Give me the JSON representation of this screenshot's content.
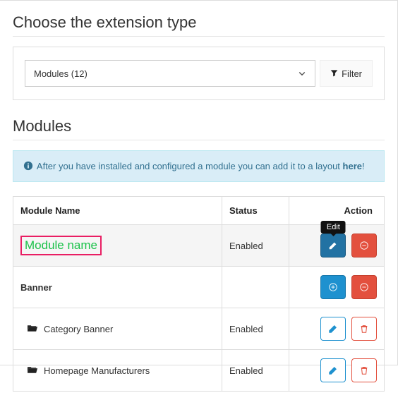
{
  "section1": {
    "title": "Choose the extension type"
  },
  "select": {
    "label": "Modules (12)"
  },
  "filter": {
    "label": "Filter"
  },
  "section2": {
    "title": "Modules"
  },
  "alert": {
    "text": "After you have installed and configured a module you can add it to a layout ",
    "linkText": "here",
    "after": "!"
  },
  "table": {
    "headers": {
      "name": "Module Name",
      "status": "Status",
      "action": "Action"
    },
    "rows": [
      {
        "name": "Module name",
        "status": "Enabled",
        "tooltip": "Edit"
      },
      {
        "name": "Banner",
        "status": ""
      },
      {
        "name": "Category Banner",
        "status": "Enabled"
      },
      {
        "name": "Homepage Manufacturers",
        "status": "Enabled"
      }
    ]
  }
}
